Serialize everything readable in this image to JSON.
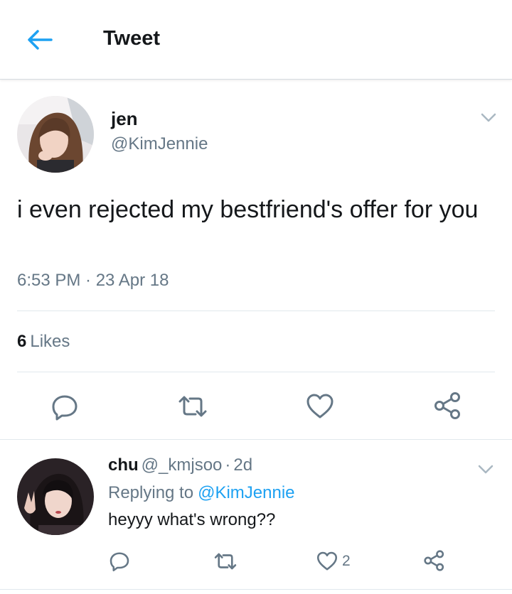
{
  "header": {
    "title": "Tweet",
    "back_icon": "arrow-left-icon"
  },
  "tweet": {
    "name": "jen",
    "handle": "@KimJennie",
    "text": "i even rejected my bestfriend's offer for you",
    "time": "6:53 PM · 23 Apr 18",
    "likes_count": "6",
    "likes_label": "Likes",
    "actions": [
      "reply-icon",
      "retweet-icon",
      "heart-icon",
      "share-icon"
    ]
  },
  "reply": {
    "name": "chu",
    "handle": "@_kmjsoo",
    "separator": "·",
    "time": "2d",
    "replying_prefix": "Replying to",
    "replying_to": "@KimJennie",
    "text": "heyyy what's wrong??",
    "like_count": "2"
  },
  "colors": {
    "accent": "#1da1f2",
    "secondary_text": "#657786",
    "primary_text": "#14171a",
    "divider": "#e1e8ed"
  }
}
